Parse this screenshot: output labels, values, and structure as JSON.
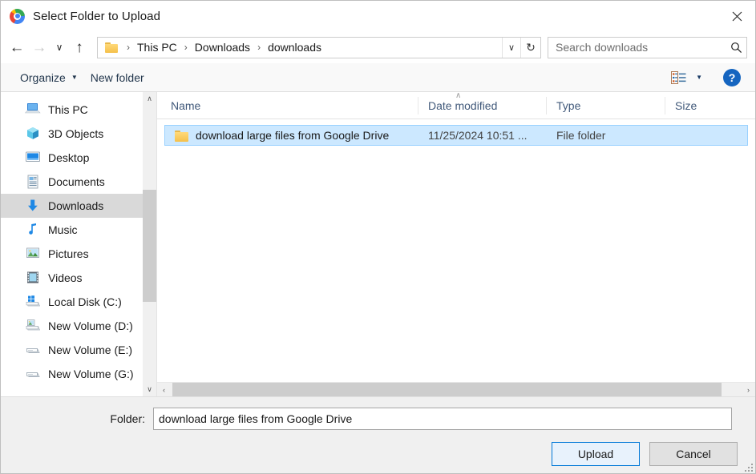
{
  "window": {
    "title": "Select Folder to Upload",
    "app_icon": "chrome-icon",
    "close_label": "✕"
  },
  "nav": {
    "back_icon": "←",
    "forward_icon": "→",
    "recent_icon": "∨",
    "up_icon": "↑",
    "breadcrumb": [
      "This PC",
      "Downloads",
      "downloads"
    ],
    "separator": "›",
    "dropdown_icon": "∨",
    "refresh_icon": "↻"
  },
  "search": {
    "placeholder": "Search downloads",
    "value": "",
    "icon": "search-icon"
  },
  "toolbar": {
    "organize_label": "Organize",
    "organize_caret": "▼",
    "new_folder_label": "New folder",
    "view_caret": "▼",
    "help_label": "?"
  },
  "sidebar": {
    "items": [
      {
        "label": "This PC",
        "icon": "computer-icon",
        "selected": false
      },
      {
        "label": "3D Objects",
        "icon": "cube-icon",
        "selected": false
      },
      {
        "label": "Desktop",
        "icon": "desktop-icon",
        "selected": false
      },
      {
        "label": "Documents",
        "icon": "document-icon",
        "selected": false
      },
      {
        "label": "Downloads",
        "icon": "download-arrow-icon",
        "selected": true
      },
      {
        "label": "Music",
        "icon": "music-note-icon",
        "selected": false
      },
      {
        "label": "Pictures",
        "icon": "picture-icon",
        "selected": false
      },
      {
        "label": "Videos",
        "icon": "video-icon",
        "selected": false
      },
      {
        "label": "Local Disk (C:)",
        "icon": "windows-drive-icon",
        "selected": false
      },
      {
        "label": "New Volume (D:)",
        "icon": "drive-image-icon",
        "selected": false
      },
      {
        "label": "New Volume (E:)",
        "icon": "drive-icon",
        "selected": false
      },
      {
        "label": "New Volume (G:)",
        "icon": "drive-icon",
        "selected": false
      }
    ],
    "scroll_up_icon": "∧",
    "scroll_down_icon": "∨"
  },
  "filelist": {
    "columns": [
      "Name",
      "Date modified",
      "Type",
      "Size"
    ],
    "sort_indicator": "∧",
    "rows": [
      {
        "name": "download large files from Google Drive",
        "date_modified": "11/25/2024 10:51 ...",
        "type": "File folder",
        "size": "",
        "icon": "folder-icon",
        "selected": true
      }
    ],
    "scroll_left_icon": "‹",
    "scroll_right_icon": "›"
  },
  "footer": {
    "folder_label": "Folder:",
    "folder_value": "download large files from Google Drive",
    "upload_label": "Upload",
    "cancel_label": "Cancel"
  },
  "colors": {
    "selection_blue": "#cce8ff",
    "selection_border": "#99d1ff",
    "sidebar_selected": "#d9d9d9",
    "accent_focus": "#0078d7",
    "header_text": "#41597a",
    "help_blue": "#1565c0"
  }
}
